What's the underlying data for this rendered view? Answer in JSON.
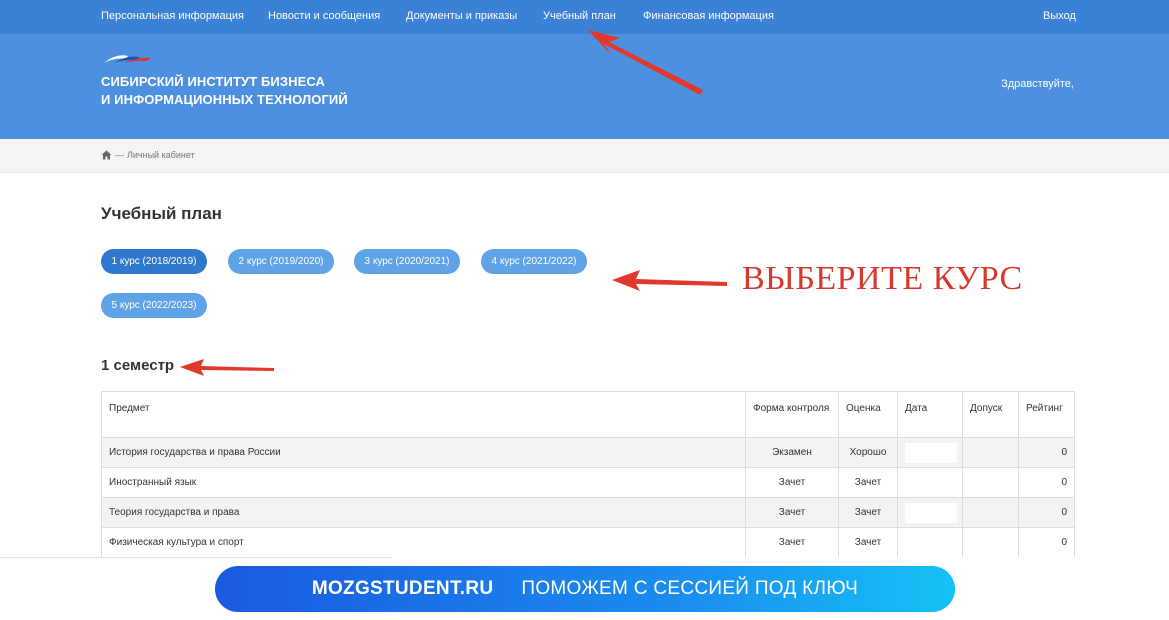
{
  "nav": {
    "personal": "Персональная информация",
    "news": "Новости и сообщения",
    "documents": "Документы и приказы",
    "plan": "Учебный план",
    "finance": "Финансовая информация",
    "logout": "Выход"
  },
  "header": {
    "brand_line1": "СИБИРСКИЙ ИНСТИТУТ БИЗНЕСА",
    "brand_line2": "И ИНФОРМАЦИОННЫХ ТЕХНОЛОГИЙ",
    "greeting": "Здравствуйте,"
  },
  "breadcrumb": {
    "icon": "home-icon",
    "separator": "—",
    "current": "Личный кабинет"
  },
  "page": {
    "title": "Учебный план",
    "semester": "1 семестр"
  },
  "courses": [
    {
      "label": "1 курс (2018/2019)",
      "active": true
    },
    {
      "label": "2 курс (2019/2020)",
      "active": false
    },
    {
      "label": "3 курс (2020/2021)",
      "active": false
    },
    {
      "label": "4 курс (2021/2022)",
      "active": false
    },
    {
      "label": "5 курс (2022/2023)",
      "active": false
    }
  ],
  "annotation": "ВЫБЕРИТЕ КУРС",
  "table": {
    "headers": [
      "Предмет",
      "Форма контроля",
      "Оценка",
      "Дата",
      "Допуск",
      "Рейтинг"
    ],
    "rows": [
      {
        "subject": "История государства и права России",
        "control": "Экзамен",
        "grade": "Хорошо",
        "date": "",
        "admission": "",
        "rating": "0"
      },
      {
        "subject": "Иностранный язык",
        "control": "Зачет",
        "grade": "Зачет",
        "date": "",
        "admission": "",
        "rating": "0"
      },
      {
        "subject": "Теория государства и права",
        "control": "Зачет",
        "grade": "Зачет",
        "date": "",
        "admission": "",
        "rating": "0"
      },
      {
        "subject": "Физическая культура и спорт",
        "control": "Зачет",
        "grade": "Зачет",
        "date": "",
        "admission": "",
        "rating": "0"
      }
    ]
  },
  "banner": {
    "site": "MOZGSTUDENT.RU",
    "slogan": "ПОМОЖЕМ С СЕССИЕЙ ПОД КЛЮЧ"
  },
  "colors": {
    "nav_bg": "#3b82d6",
    "header_bg": "#4d90df",
    "pill_active": "#2f78cc",
    "pill": "#5fa3e6",
    "annotation_red": "#d6392e"
  }
}
